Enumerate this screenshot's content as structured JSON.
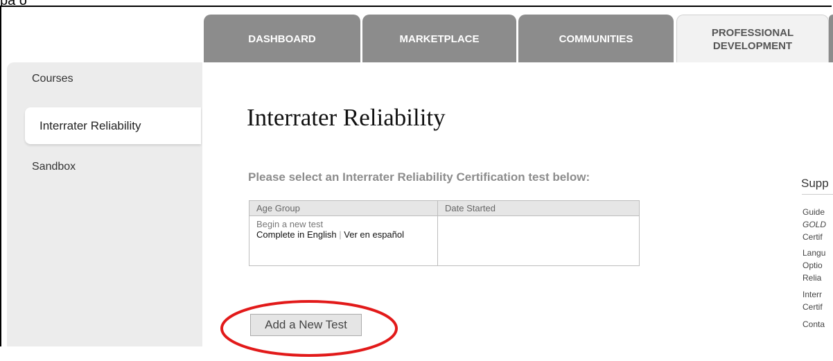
{
  "cropped_header_text": "pa o",
  "tabs": [
    {
      "label": "DASHBOARD"
    },
    {
      "label": "MARKETPLACE"
    },
    {
      "label": "COMMUNITIES"
    },
    {
      "label_line1": "PROFESSIONAL",
      "label_line2": "DEVELOPMENT"
    }
  ],
  "sidebar": {
    "items": [
      {
        "label": "Courses"
      },
      {
        "label": "Interrater Reliability"
      },
      {
        "label": "Sandbox"
      }
    ]
  },
  "main": {
    "title": "Interrater Reliability",
    "instruction": "Please select an Interrater Reliability Certification test below:",
    "table": {
      "headers": [
        "Age Group",
        "Date Started"
      ],
      "row": {
        "begin": "Begin a new test",
        "english": "Complete in English",
        "separator": "|",
        "spanish": "Ver en español",
        "date": ""
      }
    },
    "add_button": "Add a New Test"
  },
  "support": {
    "title": "Supp",
    "links": [
      "Guide",
      "GOLD",
      "Certif",
      "Langu",
      "Optio",
      "Relia",
      "Interr",
      "Certif",
      "Conta"
    ]
  },
  "colors": {
    "tab_inactive": "#8c8c8c",
    "sidebar_bg": "#ececec",
    "annotation": "#e21a1a"
  }
}
